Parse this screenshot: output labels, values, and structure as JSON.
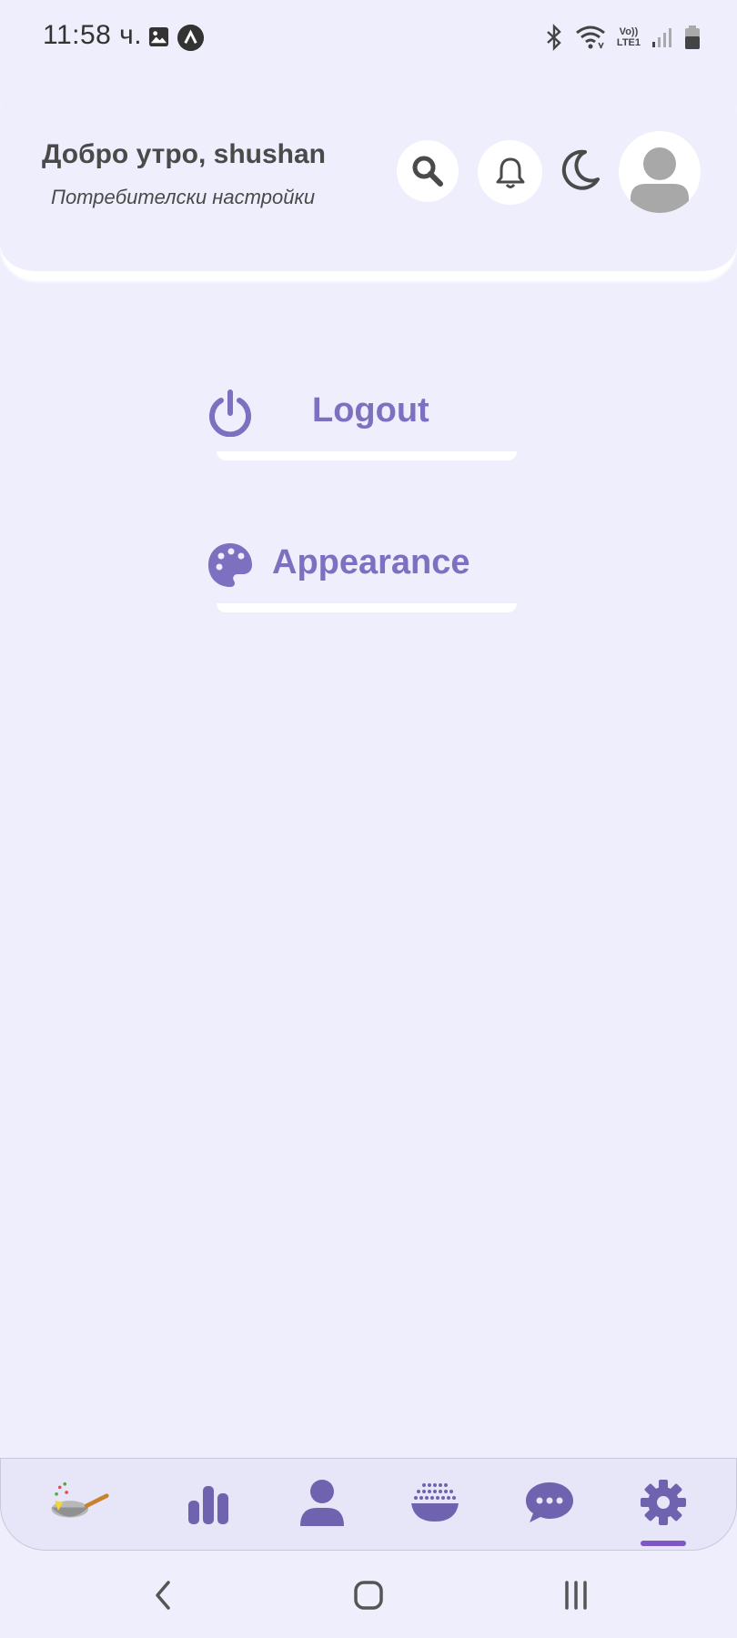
{
  "status_bar": {
    "time": "11:58 ч.",
    "icons": [
      "gallery-icon",
      "a-badge-icon",
      "bluetooth-icon",
      "wifi-icon",
      "volte-icon",
      "signal-icon",
      "battery-icon"
    ],
    "volte_top": "Vo))",
    "volte_bottom": "LTE1"
  },
  "header": {
    "greeting": "Добро утро, shushan",
    "subtitle": "Потребителски настройки",
    "icons": [
      "search-icon",
      "bell-icon",
      "moon-icon",
      "avatar-icon"
    ]
  },
  "menu": {
    "items": [
      {
        "label": "Logout",
        "icon": "power-icon"
      },
      {
        "label": "Appearance",
        "icon": "palette-icon"
      }
    ]
  },
  "bottom_nav": {
    "items": [
      "wok-icon",
      "stats-icon",
      "profile-icon",
      "food-bowl-icon",
      "chat-icon",
      "settings-icon"
    ],
    "active": "settings-icon"
  },
  "colors": {
    "background": "#eeeefd",
    "accent": "#7d70c0",
    "active_indicator": "#7e57c2"
  }
}
